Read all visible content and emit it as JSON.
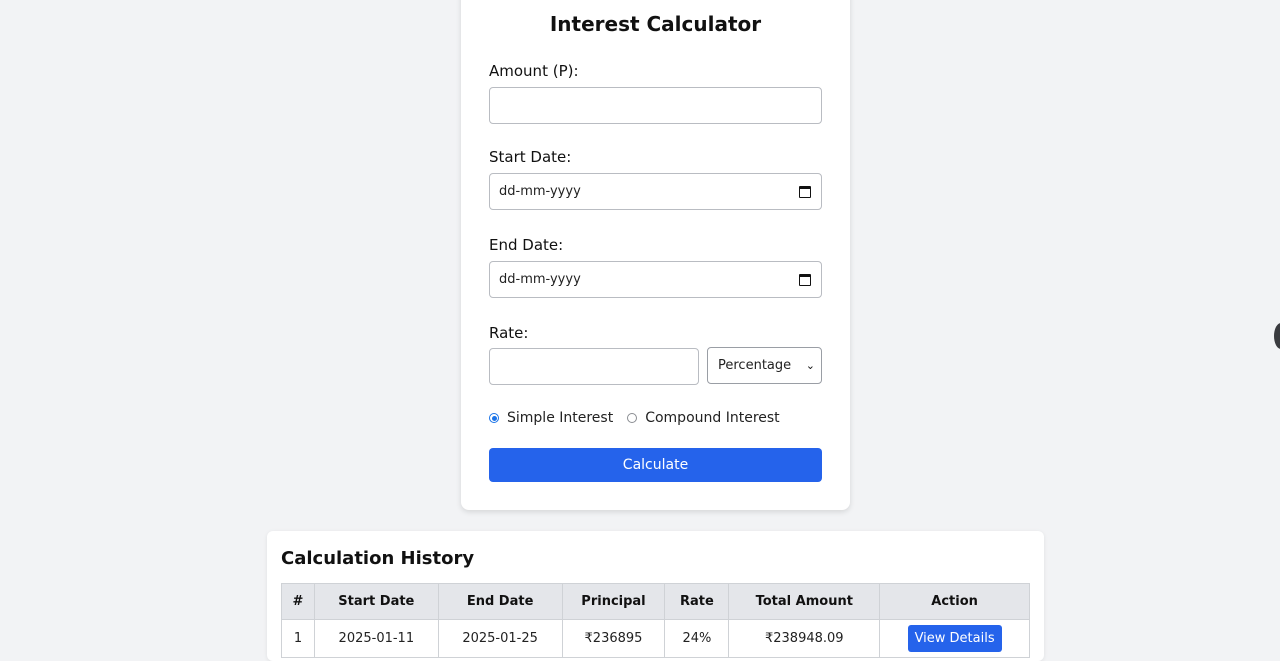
{
  "calculator": {
    "title": "Interest Calculator",
    "amount_label": "Amount (P):",
    "amount_value": "",
    "start_date_label": "Start Date:",
    "start_date_placeholder": "dd-mm-yyyy",
    "end_date_label": "End Date:",
    "end_date_placeholder": "dd-mm-yyyy",
    "rate_label": "Rate:",
    "rate_value": "",
    "rate_type_selected": "Percentage",
    "radio_simple": "Simple Interest",
    "radio_compound": "Compound Interest",
    "selected_interest_type": "Simple Interest",
    "calculate_label": "Calculate"
  },
  "history": {
    "title": "Calculation History",
    "columns": [
      "#",
      "Start Date",
      "End Date",
      "Principal",
      "Rate",
      "Total Amount",
      "Action"
    ],
    "rows": [
      {
        "index": "1",
        "start_date": "2025-01-11",
        "end_date": "2025-01-25",
        "principal": "₹236895",
        "rate": "24%",
        "total_amount": "₹238948.09",
        "action_label": "View Details"
      }
    ]
  },
  "colors": {
    "accent": "#2563eb",
    "background": "#f2f3f5",
    "card": "#ffffff",
    "table_header": "#e4e6ea"
  }
}
